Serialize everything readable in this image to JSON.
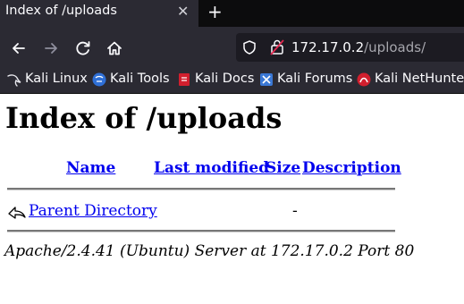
{
  "browser": {
    "tab": {
      "title": "Index of /uploads",
      "close": "✕"
    },
    "new_tab": "+",
    "url": {
      "host": "172.17.0.2",
      "path": "/uploads/"
    },
    "bookmarks": [
      {
        "label": "Kali Linux",
        "icon": "kali-dragon-icon"
      },
      {
        "label": "Kali Tools",
        "icon": "kali-tools-icon"
      },
      {
        "label": "Kali Docs",
        "icon": "kali-docs-icon"
      },
      {
        "label": "Kali Forums",
        "icon": "kali-forums-icon"
      },
      {
        "label": "Kali NetHunter",
        "icon": "kali-nethunter-icon"
      }
    ],
    "colors": {
      "chrome": "#2b2a33",
      "tabstrip": "#0c0c0d",
      "urlbar": "#1c1b22",
      "link": "#0000ee"
    }
  },
  "page": {
    "heading": "Index of /uploads",
    "columns": {
      "name": "Name",
      "modified": "Last modified",
      "size": "Size",
      "description": "Description"
    },
    "rows": [
      {
        "name": "Parent Directory",
        "modified": "",
        "size": "-",
        "description": "",
        "icon": "back-arrow-icon"
      }
    ],
    "address": "Apache/2.4.41 (Ubuntu) Server at 172.17.0.2 Port 80"
  }
}
